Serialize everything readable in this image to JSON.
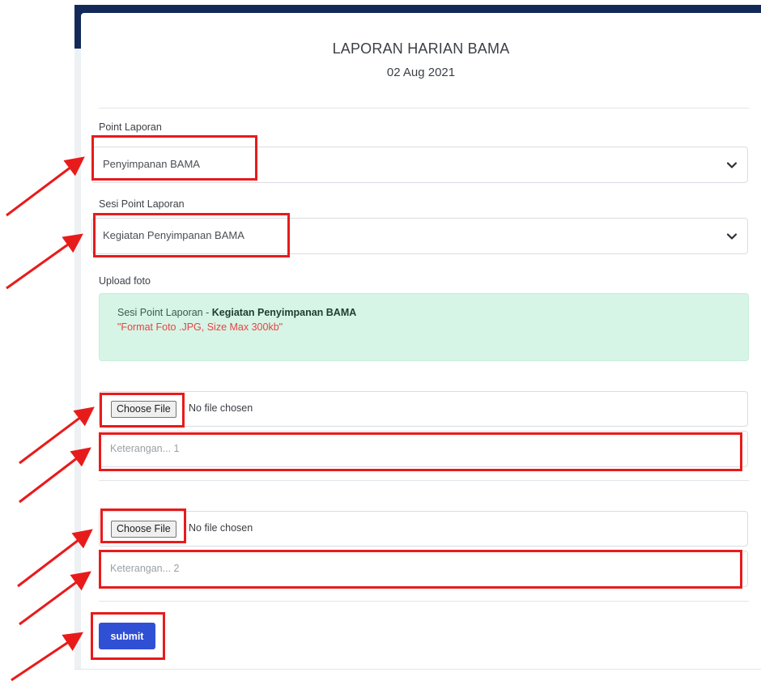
{
  "header": {
    "title": "LAPORAN HARIAN BAMA",
    "date": "02 Aug 2021"
  },
  "form": {
    "point_label": "Point Laporan",
    "point_value": "Penyimpanan BAMA",
    "sesi_label": "Sesi Point Laporan",
    "sesi_value": "Kegiatan Penyimpanan BAMA",
    "upload_label": "Upload foto",
    "alert": {
      "prefix": "Sesi Point Laporan - ",
      "session_name": "Kegiatan Penyimpanan BAMA",
      "note": "\"Format Foto .JPG, Size Max 300kb\""
    },
    "uploads": [
      {
        "button_label": "Choose File",
        "status": "No file chosen",
        "placeholder": "Keterangan... 1"
      },
      {
        "button_label": "Choose File",
        "status": "No file chosen",
        "placeholder": "Keterangan... 2"
      }
    ],
    "submit_label": "submit"
  },
  "colors": {
    "navy": "#132a59",
    "alert_bg": "#d7f5e6",
    "alert_note": "#e64343",
    "submit_bg": "#2f4fd4",
    "highlight_red": "#e81b1b"
  },
  "icons": {
    "select_chevron": "chevron-down-icon",
    "annotation": "red-arrow-icon"
  }
}
